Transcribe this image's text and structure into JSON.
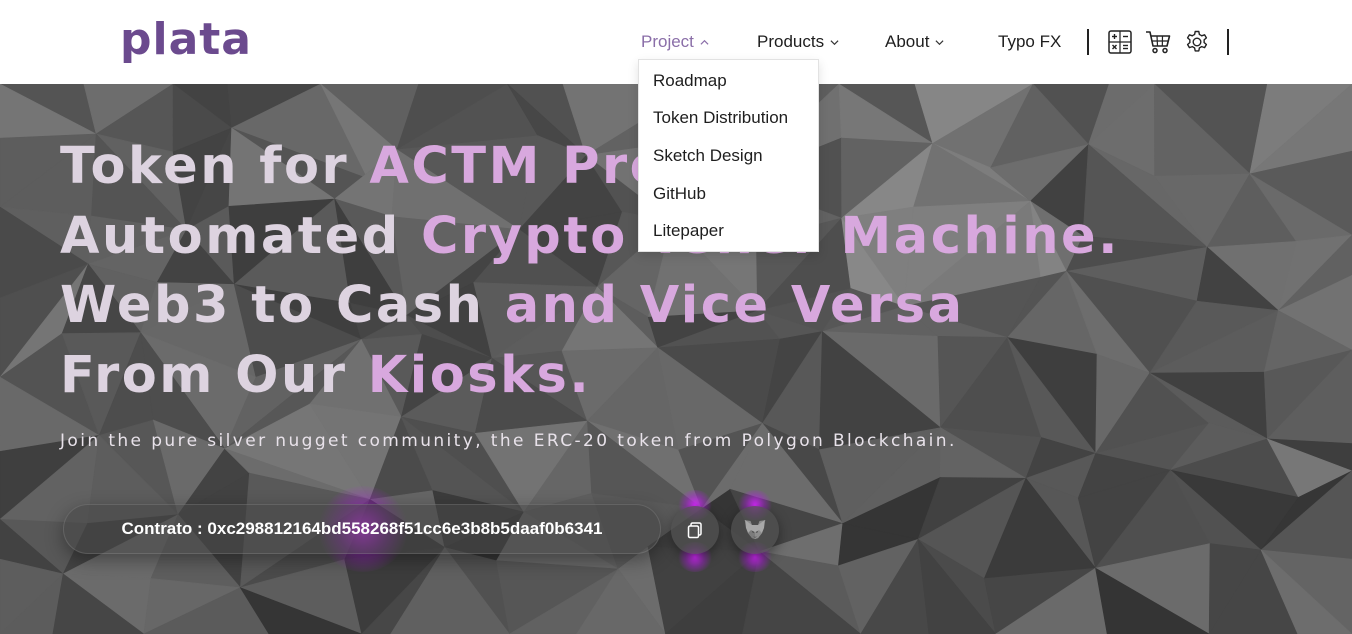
{
  "brand": {
    "logo_text": "plata",
    "logo_color": "#6b4a8e"
  },
  "nav": {
    "items": [
      {
        "label": "Project",
        "icon": "chevron-up-icon",
        "active": true
      },
      {
        "label": "Products",
        "icon": "chevron-down-icon"
      },
      {
        "label": "About",
        "icon": "chevron-down-icon"
      },
      {
        "label": "Typo FX"
      }
    ],
    "icons": [
      "calculator-icon",
      "cart-icon",
      "gear-icon"
    ],
    "active_color": "#8a6ea8"
  },
  "dropdown": {
    "items": [
      "Roadmap",
      "Token Distribution",
      "Sketch Design",
      "GitHub",
      "Litepaper"
    ]
  },
  "hero": {
    "lines": [
      [
        {
          "text": "Token for ",
          "tone": "light"
        },
        {
          "text": "ACTM Project",
          "tone": "purple"
        }
      ],
      [
        {
          "text": "Automated ",
          "tone": "light"
        },
        {
          "text": "Crypto Teller Machine.",
          "tone": "purple"
        }
      ],
      [
        {
          "text": "Web3 to Cash ",
          "tone": "light"
        },
        {
          "text": "and Vice Versa",
          "tone": "purple"
        }
      ],
      [
        {
          "text": "From Our ",
          "tone": "light"
        },
        {
          "text": "Kiosks.",
          "tone": "purple"
        }
      ]
    ],
    "subtitle": "Join the pure silver nugget community, the ERC-20 token from Polygon Blockchain.",
    "contract_text": "Contrato : 0xc298812164bd558268f51cc6e3b8b5daaf0b6341",
    "buttons": [
      "copy-icon",
      "metamask-fox-icon"
    ],
    "colors": {
      "light": "#ddd3e0",
      "purple": "#d8a8de",
      "glow": "#d628ff"
    }
  }
}
